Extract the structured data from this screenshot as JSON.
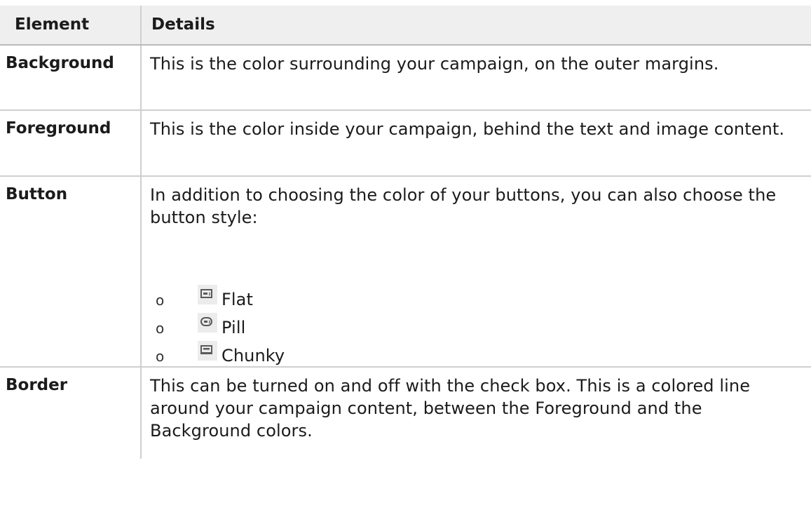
{
  "table": {
    "headers": {
      "element": "Element",
      "details": "Details"
    },
    "rows": [
      {
        "term": "Background",
        "description": "This is the color surrounding your campaign, on the outer margins."
      },
      {
        "term": "Foreground",
        "description": "This is the color inside your campaign, behind the text and image content."
      },
      {
        "term": "Button",
        "description": "In addition to choosing the color of your buttons, you can also choose the button style:",
        "styles": [
          {
            "bullet": "o",
            "icon": "button-flat-icon",
            "label": "Flat"
          },
          {
            "bullet": "o",
            "icon": "button-pill-icon",
            "label": "Pill"
          },
          {
            "bullet": "o",
            "icon": "button-chunky-icon",
            "label": "Chunky"
          }
        ]
      },
      {
        "term": "Border",
        "description": "This can be turned on and off with the check box. This is a colored line around your campaign content, between the Foreground and the Background colors."
      }
    ]
  },
  "colors": {
    "header_background": "#efefef",
    "border": "#cfcfcf",
    "icon_background": "#ececec",
    "icon_glyph": "#5a5a5a"
  }
}
